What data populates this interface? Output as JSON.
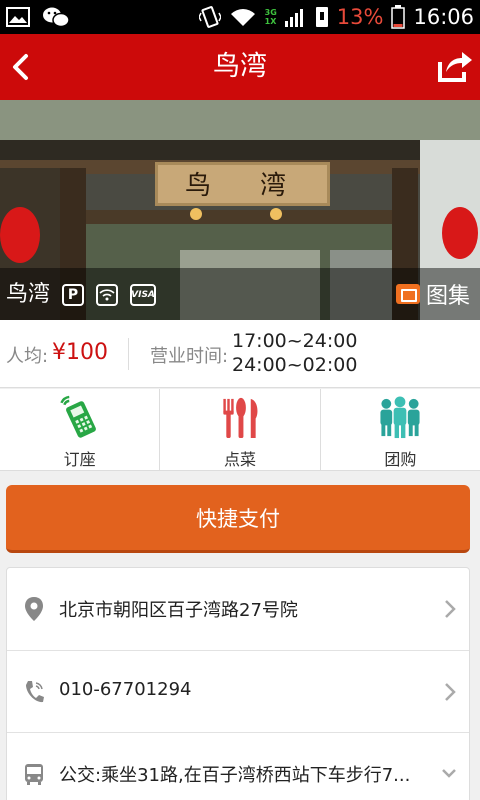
{
  "status_bar": {
    "network_top": "3G",
    "network_bottom": "1X",
    "battery": "13%",
    "time": "16:06",
    "icons": [
      "image-icon",
      "wechat-icon",
      "vibrate-icon",
      "wifi-icon",
      "signal-icon",
      "sim-icon",
      "battery-icon"
    ]
  },
  "header": {
    "title": "鸟湾",
    "back_icon": "back-arrow-icon",
    "share_icon": "share-icon"
  },
  "hero": {
    "name": "鸟湾",
    "amenities": [
      {
        "icon": "parking-icon",
        "text": "P"
      },
      {
        "icon": "wifi-icon"
      },
      {
        "icon": "visa-card-icon",
        "text": "VISA"
      }
    ],
    "gallery_label": "图集"
  },
  "info": {
    "avg_label": "人均:",
    "avg_value": "¥100",
    "hours_label": "营业时间:",
    "hours": [
      "17:00~24:00",
      "24:00~02:00"
    ]
  },
  "actions": [
    {
      "label": "订座",
      "icon": "phone-reserve-icon"
    },
    {
      "label": "点菜",
      "icon": "cutlery-icon"
    },
    {
      "label": "团购",
      "icon": "group-people-icon"
    }
  ],
  "pay_button": "快捷支付",
  "details": {
    "address": "北京市朝阳区百子湾路27号院",
    "phone": "010-67701294",
    "bus": "公交:乘坐31路,在百子湾桥西站下车步行7..."
  },
  "colors": {
    "header": "#cc0a0a",
    "price": "#cc1111",
    "pay_button": "#e2621e",
    "phone_icon": "#28a745",
    "cutlery_icon": "#e04848",
    "group_icon": "#2aa39a"
  }
}
